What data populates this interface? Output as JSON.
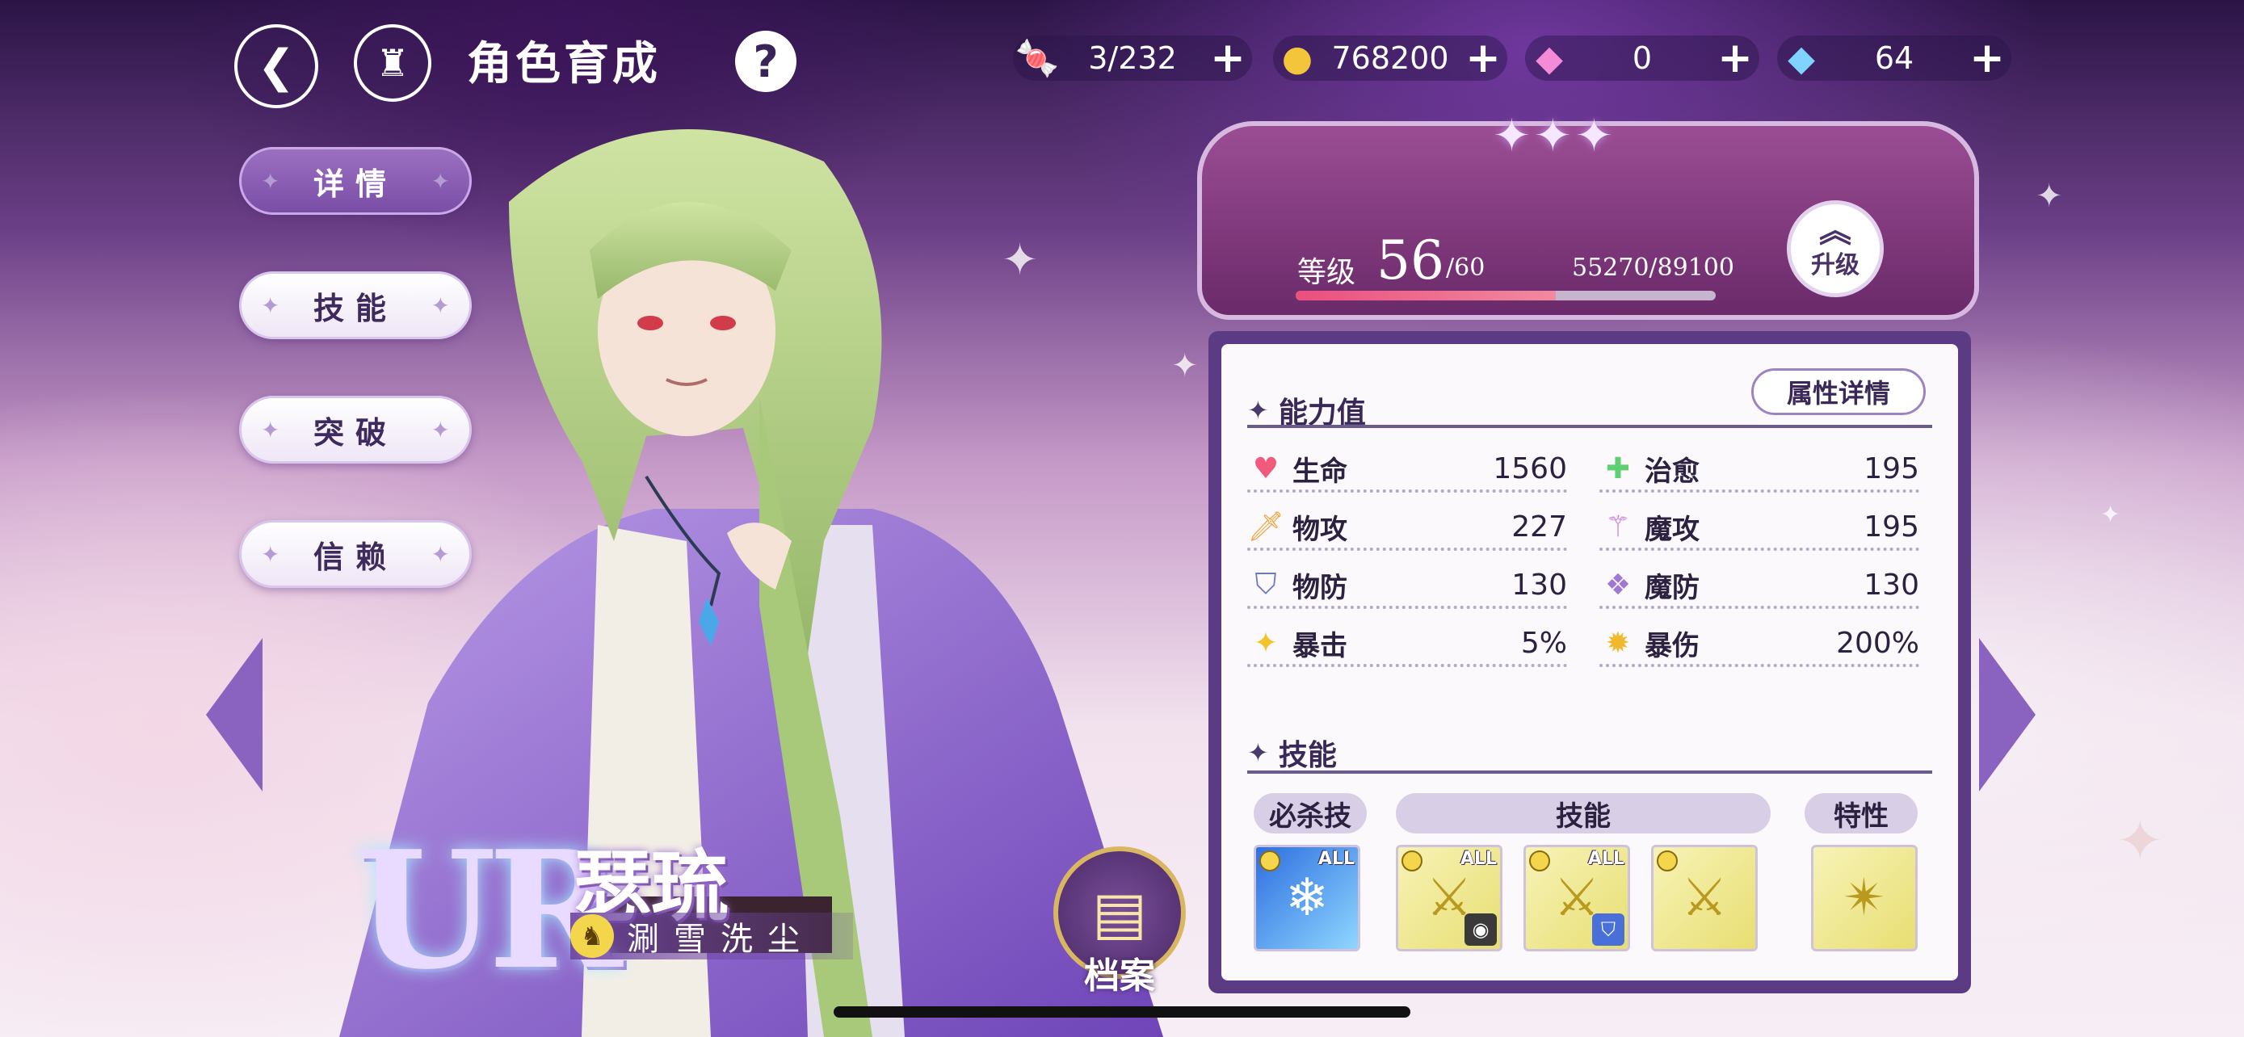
{
  "header": {
    "title": "角色育成",
    "help": "?"
  },
  "currencies": [
    {
      "icon": "candy-icon",
      "value": "3/232"
    },
    {
      "icon": "gold-coin-icon",
      "value": "768200"
    },
    {
      "icon": "pink-diamond-icon",
      "value": "0"
    },
    {
      "icon": "blue-diamond-icon",
      "value": "64"
    }
  ],
  "plus_label": "+",
  "menu": [
    "详情",
    "技能",
    "突破",
    "信赖"
  ],
  "character": {
    "rarity": "UR",
    "name": "瑟琉",
    "subtitle": "涮雪洗尘"
  },
  "archive": {
    "label": "档案"
  },
  "level": {
    "label": "等级",
    "current": "56",
    "max": "/60",
    "exp": "55270/89100",
    "progress": 0.62,
    "upgrade_label": "升级"
  },
  "stats": {
    "section_title": "能力值",
    "detail_button": "属性详情",
    "items": [
      {
        "icon": "heart-icon",
        "name": "生命",
        "value": "1560"
      },
      {
        "icon": "heal-icon",
        "name": "治愈",
        "value": "195"
      },
      {
        "icon": "physical-attack-icon",
        "name": "物攻",
        "value": "227"
      },
      {
        "icon": "magic-attack-icon",
        "name": "魔攻",
        "value": "195"
      },
      {
        "icon": "physical-defense-icon",
        "name": "物防",
        "value": "130"
      },
      {
        "icon": "magic-defense-icon",
        "name": "魔防",
        "value": "130"
      },
      {
        "icon": "crit-icon",
        "name": "暴击",
        "value": "5%"
      },
      {
        "icon": "crit-damage-icon",
        "name": "暴伤",
        "value": "200%"
      }
    ]
  },
  "skills": {
    "section_title": "技能",
    "tags": [
      "必杀技",
      "技能",
      "特性"
    ],
    "all_label": "ALL"
  }
}
